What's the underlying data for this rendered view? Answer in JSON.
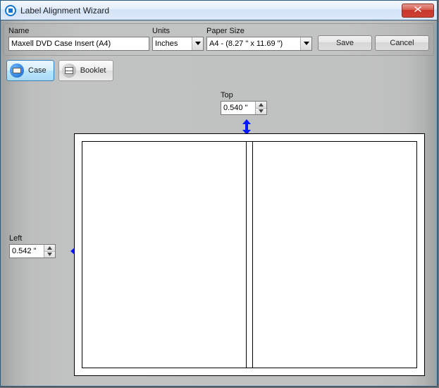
{
  "window": {
    "title": "Label Alignment Wizard"
  },
  "config": {
    "name_label": "Name",
    "name_value": "Maxell DVD Case Insert (A4)",
    "units_label": "Units",
    "units_value": "Inches",
    "paper_label": "Paper Size",
    "paper_value": "A4 - (8.27 \" x 11.69 \")",
    "save_label": "Save",
    "cancel_label": "Cancel"
  },
  "tabs": {
    "case_label": "Case",
    "booklet_label": "Booklet"
  },
  "margins": {
    "top_label": "Top",
    "top_value": "0.540 \"",
    "left_label": "Left",
    "left_value": "0.542 \""
  },
  "icons": {
    "app": "disc-icon",
    "close": "close-icon",
    "dropdown": "chevron-down-icon",
    "spin_up": "chevron-up-icon",
    "spin_down": "chevron-down-icon",
    "case": "case-icon",
    "booklet": "booklet-icon",
    "v_arrow": "vertical-double-arrow-icon",
    "h_arrow": "horizontal-double-arrow-icon"
  }
}
